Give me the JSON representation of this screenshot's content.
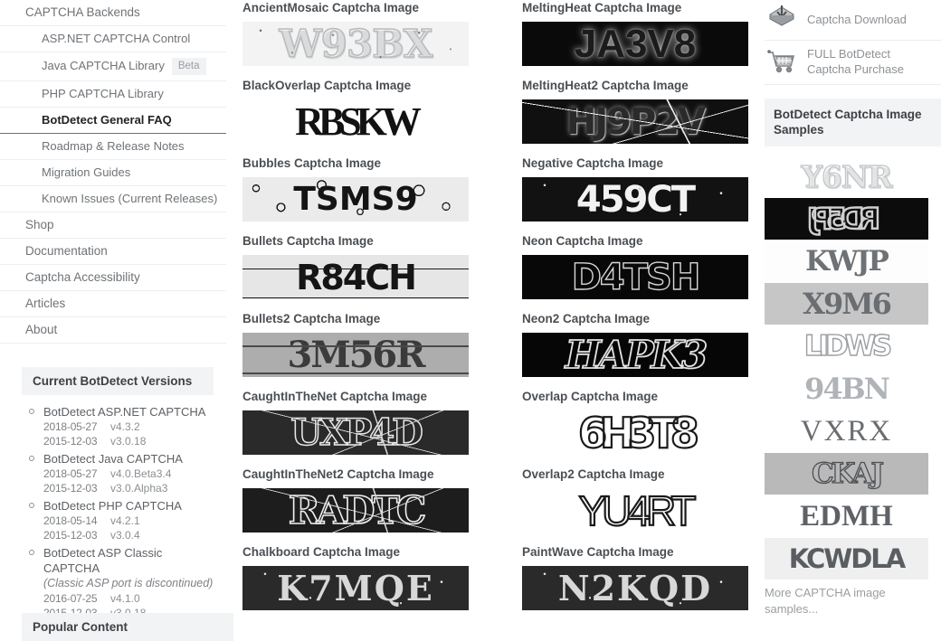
{
  "sidebar": {
    "nav": [
      {
        "label": "CAPTCHA Backends",
        "level": 0,
        "active": false,
        "badge": null
      },
      {
        "label": "ASP.NET CAPTCHA Control",
        "level": 1,
        "active": false,
        "badge": null
      },
      {
        "label": "Java CAPTCHA Library",
        "level": 1,
        "active": false,
        "badge": "Beta"
      },
      {
        "label": "PHP CAPTCHA Library",
        "level": 1,
        "active": false,
        "badge": null
      },
      {
        "label": "BotDetect General FAQ",
        "level": 1,
        "active": true,
        "badge": null
      },
      {
        "label": "Roadmap & Release Notes",
        "level": 1,
        "active": false,
        "badge": null
      },
      {
        "label": "Migration Guides",
        "level": 1,
        "active": false,
        "badge": null
      },
      {
        "label": "Known Issues (Current Releases)",
        "level": 1,
        "active": false,
        "badge": null
      },
      {
        "label": "Shop",
        "level": 0,
        "active": false,
        "badge": null
      },
      {
        "label": "Documentation",
        "level": 0,
        "active": false,
        "badge": null
      },
      {
        "label": "Captcha Accessibility",
        "level": 0,
        "active": false,
        "badge": null
      },
      {
        "label": "Articles",
        "level": 0,
        "active": false,
        "badge": null
      },
      {
        "label": "About",
        "level": 0,
        "active": false,
        "badge": null
      }
    ],
    "versions_heading": "Current BotDetect Versions",
    "versions": [
      {
        "product": "BotDetect ASP.NET CAPTCHA",
        "note": null,
        "releases": [
          {
            "date": "2018-05-27",
            "version": "v4.3.2"
          },
          {
            "date": "2015-12-03",
            "version": "v3.0.18"
          }
        ]
      },
      {
        "product": "BotDetect Java CAPTCHA",
        "note": null,
        "releases": [
          {
            "date": "2018-05-27",
            "version": "v4.0.Beta3.4"
          },
          {
            "date": "2015-12-03",
            "version": "v3.0.Alpha3"
          }
        ]
      },
      {
        "product": "BotDetect PHP CAPTCHA",
        "note": null,
        "releases": [
          {
            "date": "2018-05-14",
            "version": "v4.2.1"
          },
          {
            "date": "2015-12-03",
            "version": "v3.0.4"
          }
        ]
      },
      {
        "product": "BotDetect ASP Classic CAPTCHA",
        "note": "(Classic ASP port is discontinued)",
        "releases": [
          {
            "date": "2016-07-25",
            "version": "v4.1.0"
          },
          {
            "date": "2015-12-03",
            "version": "v3.0.18"
          }
        ]
      }
    ],
    "popular_heading": "Popular Content"
  },
  "captcha_columns": [
    [
      {
        "title": "AncientMosaic Captcha Image",
        "code": "W93BX",
        "style": "s-ancientmosaic",
        "overlay": "speck"
      },
      {
        "title": "BlackOverlap Captcha Image",
        "code": "RBSKW",
        "style": "s-blackoverlap",
        "overlay": ""
      },
      {
        "title": "Bubbles Captcha Image",
        "code": "TSMS9",
        "style": "s-bubbles",
        "overlay": "bubbles"
      },
      {
        "title": "Bullets Captcha Image",
        "code": "R84CH",
        "style": "s-bullets",
        "overlay": "lines"
      },
      {
        "title": "Bullets2 Captcha Image",
        "code": "3M56R",
        "style": "s-bullets2",
        "overlay": "lines2"
      },
      {
        "title": "CaughtInTheNet Captcha Image",
        "code": "UXP4D",
        "style": "s-caught",
        "overlay": "web"
      },
      {
        "title": "CaughtInTheNet2 Captcha Image",
        "code": "RADTC",
        "style": "s-caught2",
        "overlay": "web"
      },
      {
        "title": "Chalkboard Captcha Image",
        "code": "K7MQE",
        "style": "s-chalk",
        "overlay": "speckw"
      }
    ],
    [
      {
        "title": "MeltingHeat Captcha Image",
        "code": "JA3V8",
        "style": "s-meltingheat",
        "overlay": ""
      },
      {
        "title": "MeltingHeat2 Captcha Image",
        "code": "HJ9P2V",
        "style": "s-meltingheat2",
        "overlay": "scratch"
      },
      {
        "title": "Negative Captcha Image",
        "code": "459CT",
        "style": "s-negative",
        "overlay": "speckw"
      },
      {
        "title": "Neon Captcha Image",
        "code": "D4TSH",
        "style": "s-neon",
        "overlay": ""
      },
      {
        "title": "Neon2 Captcha Image",
        "code": "HAPK3",
        "style": "s-neon2",
        "overlay": ""
      },
      {
        "title": "Overlap Captcha Image",
        "code": "6H3T8",
        "style": "s-overlap",
        "overlay": ""
      },
      {
        "title": "Overlap2 Captcha Image",
        "code": "YU4RT",
        "style": "s-overlap2",
        "overlay": ""
      },
      {
        "title": "PaintWave Captcha Image",
        "code": "N2KQD",
        "style": "s-chalk",
        "overlay": "speckw"
      }
    ]
  ],
  "right": {
    "links": [
      {
        "label": "Captcha Download",
        "icon": "download-icon"
      },
      {
        "label": "FULL BotDetect\nCaptcha Purchase",
        "icon": "shopping-cart-icon"
      }
    ],
    "link1_label": "Captcha Download",
    "link2_label": "FULL BotDetect Captcha Purchase",
    "samples_heading": "BotDetect Captcha Image Samples",
    "samples": [
      {
        "code": "Y6NR",
        "style": "sp1"
      },
      {
        "code": "RD5PJ",
        "style": "sp2"
      },
      {
        "code": "KWJP",
        "style": "sp3"
      },
      {
        "code": "X9M6",
        "style": "sp4"
      },
      {
        "code": "LIDWS",
        "style": "sp5"
      },
      {
        "code": "94BN",
        "style": "sp6"
      },
      {
        "code": "VXRX",
        "style": "sp7"
      },
      {
        "code": "CKAJ",
        "style": "sp8"
      },
      {
        "code": "EDMH",
        "style": "sp9"
      },
      {
        "code": "KCWDLA",
        "style": "sp10"
      }
    ],
    "more_label": "More CAPTCHA image samples...",
    "more_label_ghost": "amples..."
  },
  "colors": {
    "panel_gray": "#f2f3f4",
    "text_muted": "#8d9195",
    "text_dark": "#3d4145",
    "divider": "#ececec"
  }
}
